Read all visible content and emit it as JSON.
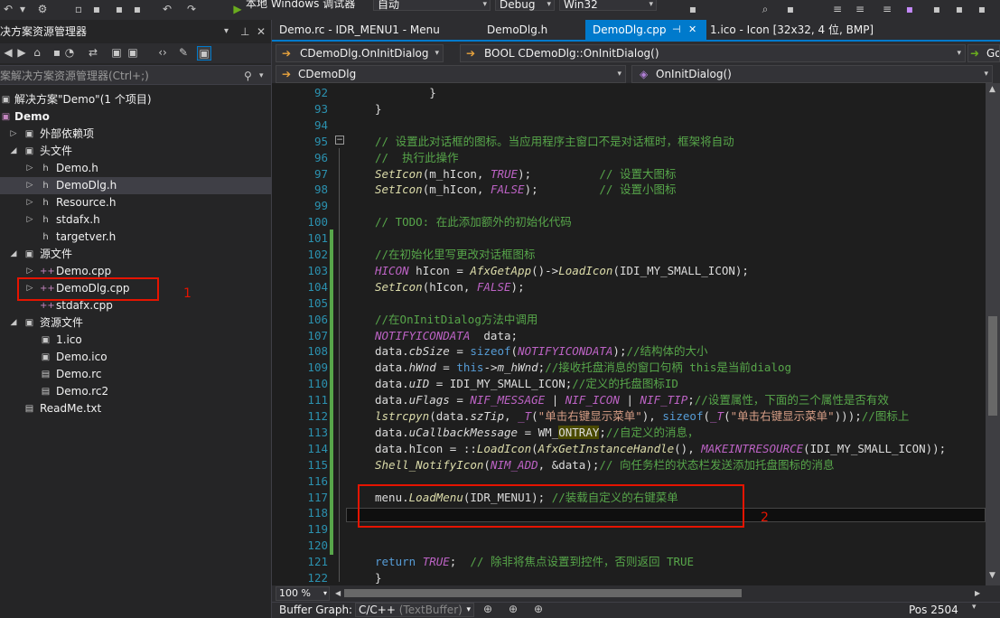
{
  "toolbar": {
    "debugger_label": "本地 Windows 调试器",
    "combo_auto": "自动",
    "combo_config": "Debug",
    "combo_platform": "Win32"
  },
  "solution_explorer": {
    "title": "决方案资源管理器",
    "search_placeholder": "案解决方案资源管理器(Ctrl+;)",
    "items": [
      {
        "label": "解决方案\"Demo\"(1 个项目)",
        "indent": 0,
        "icon": "solution-icon",
        "expander": "",
        "bold": false
      },
      {
        "label": "Demo",
        "indent": 0,
        "icon": "project-icon",
        "expander": "",
        "bold": true
      },
      {
        "label": "外部依赖项",
        "indent": 1,
        "icon": "dependencies-icon",
        "expander": "▷",
        "bold": false
      },
      {
        "label": "头文件",
        "indent": 1,
        "icon": "folder-icon",
        "expander": "◢",
        "bold": false
      },
      {
        "label": "Demo.h",
        "indent": 2,
        "icon": "header-file-icon",
        "expander": "▷",
        "bold": false
      },
      {
        "label": "DemoDlg.h",
        "indent": 2,
        "icon": "header-file-icon",
        "expander": "▷",
        "bold": false
      },
      {
        "label": "Resource.h",
        "indent": 2,
        "icon": "header-file-icon",
        "expander": "▷",
        "bold": false
      },
      {
        "label": "stdafx.h",
        "indent": 2,
        "icon": "header-file-icon",
        "expander": "▷",
        "bold": false
      },
      {
        "label": "targetver.h",
        "indent": 2,
        "icon": "header-file-icon",
        "expander": "",
        "bold": false
      },
      {
        "label": "源文件",
        "indent": 1,
        "icon": "folder-icon",
        "expander": "◢",
        "bold": false
      },
      {
        "label": "Demo.cpp",
        "indent": 2,
        "icon": "cpp-file-icon",
        "expander": "▷",
        "bold": false
      },
      {
        "label": "DemoDlg.cpp",
        "indent": 2,
        "icon": "cpp-file-icon",
        "expander": "▷",
        "bold": false
      },
      {
        "label": "stdafx.cpp",
        "indent": 2,
        "icon": "cpp-file-icon",
        "expander": "",
        "bold": false
      },
      {
        "label": "资源文件",
        "indent": 1,
        "icon": "folder-icon",
        "expander": "◢",
        "bold": false
      },
      {
        "label": "1.ico",
        "indent": 2,
        "icon": "image-file-icon",
        "expander": "",
        "bold": false
      },
      {
        "label": "Demo.ico",
        "indent": 2,
        "icon": "image-file-icon",
        "expander": "",
        "bold": false
      },
      {
        "label": "Demo.rc",
        "indent": 2,
        "icon": "resource-file-icon",
        "expander": "",
        "bold": false
      },
      {
        "label": "Demo.rc2",
        "indent": 2,
        "icon": "resource-file-icon",
        "expander": "",
        "bold": false
      },
      {
        "label": "ReadMe.txt",
        "indent": 1,
        "icon": "text-file-icon",
        "expander": "",
        "bold": false
      }
    ],
    "annotation_1": "1"
  },
  "tabs": [
    {
      "label": "Demo.rc - IDR_MENU1 - Menu",
      "active": false
    },
    {
      "label": "DemoDlg.h",
      "active": false
    },
    {
      "label": "DemoDlg.cpp",
      "active": true
    },
    {
      "label": "1.ico - Icon [32x32, 4 位, BMP]",
      "active": false
    }
  ],
  "nav": {
    "scope_combo": "CDemoDlg.OnInitDialog",
    "function_combo": "BOOL CDemoDlg::OnInitDialog()",
    "go_label": "Go",
    "class_combo": "CDemoDlg",
    "member_combo": "OnInitDialog()"
  },
  "editor": {
    "lines": [
      {
        "n": "92",
        "html": "        <span>}</span>"
      },
      {
        "n": "93",
        "html": "<span>}</span>"
      },
      {
        "n": "94",
        "html": ""
      },
      {
        "n": "95",
        "html": "<span class=\"c-com\">// 设置此对话框的图标。当应用程序主窗口不是对话框时，框架将自动</span>"
      },
      {
        "n": "96",
        "html": "<span class=\"c-com\">//  执行此操作</span>"
      },
      {
        "n": "97",
        "html": "<span class=\"c-fn\">SetIcon</span>(m_hIcon, <span class=\"c-mac\">TRUE</span>);          <span class=\"c-com\">// 设置大图标</span>"
      },
      {
        "n": "98",
        "html": "<span class=\"c-fn\">SetIcon</span>(m_hIcon, <span class=\"c-mac\">FALSE</span>);         <span class=\"c-com\">// 设置小图标</span>"
      },
      {
        "n": "99",
        "html": ""
      },
      {
        "n": "100",
        "html": "<span class=\"c-com\">// TODO: 在此添加额外的初始化代码</span>"
      },
      {
        "n": "101",
        "html": ""
      },
      {
        "n": "102",
        "html": "<span class=\"c-com\">//在初始化里写更改对话框图标</span>"
      },
      {
        "n": "103",
        "html": "<span class=\"c-mac\">HICON</span> hIcon = <span class=\"c-fn\">AfxGetApp</span>()-><span class=\"c-fn\">LoadIcon</span>(IDI_MY_SMALL_ICON);"
      },
      {
        "n": "104",
        "html": "<span class=\"c-fn\">SetIcon</span>(hIcon, <span class=\"c-mac\">FALSE</span>);"
      },
      {
        "n": "105",
        "html": ""
      },
      {
        "n": "106",
        "html": "<span class=\"c-com\">//在OnInitDialog方法中调用</span>"
      },
      {
        "n": "107",
        "html": "<span class=\"c-mac\">NOTIFYICONDATA</span>  data;"
      },
      {
        "n": "108",
        "html": "data.<span class=\"c-mem\">cbSize</span> = <span class=\"c-kw\">sizeof</span>(<span class=\"c-mac\">NOTIFYICONDATA</span>);<span class=\"c-com\">//结构体的大小</span>"
      },
      {
        "n": "109",
        "html": "data.<span class=\"c-mem\">hWnd</span> = <span class=\"c-kw\">this</span>-><span class=\"c-mem\">m_hWnd</span>;<span class=\"c-com\">//接收托盘消息的窗口句柄 this是当前dialog</span>"
      },
      {
        "n": "110",
        "html": "data.<span class=\"c-mem\">uID</span> = IDI_MY_SMALL_ICON;<span class=\"c-com\">//定义的托盘图标ID</span>"
      },
      {
        "n": "111",
        "html": "data.<span class=\"c-mem\">uFlags</span> = <span class=\"c-mac\">NIF_MESSAGE</span> | <span class=\"c-mac\">NIF_ICON</span> | <span class=\"c-mac\">NIF_TIP</span>;<span class=\"c-com\">//设置属性，下面的三个属性是否有效</span>"
      },
      {
        "n": "112",
        "html": "<span class=\"c-fn\">lstrcpyn</span>(data.<span class=\"c-mem\">szTip</span>, <span class=\"c-mac\">_T</span>(<span class=\"c-str\">\"单击右键显示菜单\"</span>), <span class=\"c-kw\">sizeof</span>(<span class=\"c-mac\">_T</span>(<span class=\"c-str\">\"单击右键显示菜单\"</span>)));<span class=\"c-com\">//图标上</span>"
      },
      {
        "n": "113",
        "html": "data.<span class=\"c-mem\">uCallbackMessage</span> = WM_<span style=\"background:#4a4a00\">ONTRAY</span>;<span class=\"c-com\">//自定义的消息，</span>"
      },
      {
        "n": "114",
        "html": "data.hIcon = ::<span class=\"c-fn\">LoadIcon</span>(<span class=\"c-fn\">AfxGetInstanceHandle</span>(), <span class=\"c-mac\">MAKEINTRESOURCE</span>(IDI_MY_SMALL_ICON));"
      },
      {
        "n": "115",
        "html": "<span class=\"c-fn\">Shell_NotifyIcon</span>(<span class=\"c-mac\">NIM_ADD</span>, &amp;data);<span class=\"c-com\">// 向任务栏的状态栏发送添加托盘图标的消息</span>"
      },
      {
        "n": "116",
        "html": ""
      },
      {
        "n": "117",
        "html": "menu.<span class=\"c-fn\">LoadMenu</span>(IDR_MENU1); <span class=\"c-com\">//装载自定义的右键菜单</span>"
      },
      {
        "n": "118",
        "html": ""
      },
      {
        "n": "119",
        "html": ""
      },
      {
        "n": "120",
        "html": ""
      },
      {
        "n": "121",
        "html": "<span class=\"c-kw\">return</span> <span class=\"c-mac\">TRUE</span>;  <span class=\"c-com\">// 除非将焦点设置到控件，否则返回 TRUE</span>"
      },
      {
        "n": "122",
        "html": "<span>}</span>"
      }
    ],
    "annotation_2": "2"
  },
  "status": {
    "zoom": "100 %",
    "buffer_graph_label": "Buffer Graph:",
    "buffer_graph_value": "C/C++",
    "buffer_graph_hint": "(TextBuffer)",
    "pos": "Pos 2504"
  },
  "colors": {
    "accent": "#007acc",
    "annotation_red": "#e51400"
  }
}
